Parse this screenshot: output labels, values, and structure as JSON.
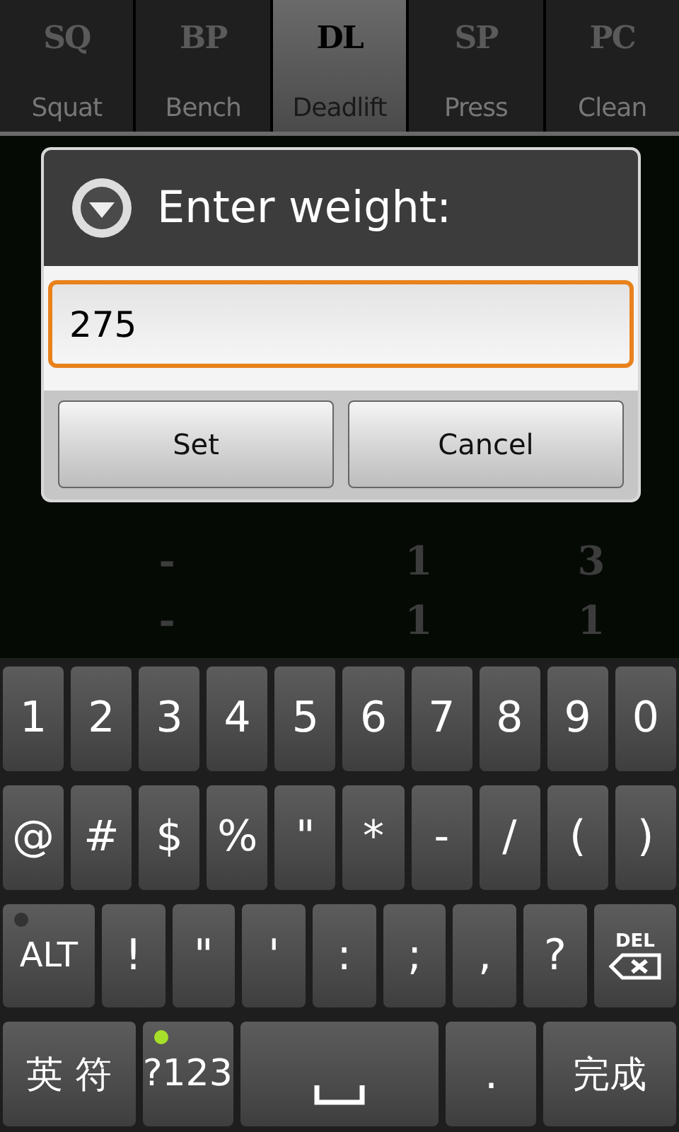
{
  "tabs": [
    {
      "abbr": "SQ",
      "label": "Squat",
      "selected": false
    },
    {
      "abbr": "BP",
      "label": "Bench",
      "selected": false
    },
    {
      "abbr": "DL",
      "label": "Deadlift",
      "selected": true
    },
    {
      "abbr": "SP",
      "label": "Press",
      "selected": false
    },
    {
      "abbr": "PC",
      "label": "Clean",
      "selected": false
    }
  ],
  "rows": [
    [
      "-",
      "1",
      "3"
    ],
    [
      "-",
      "1",
      "1"
    ]
  ],
  "dialog": {
    "title": "Enter weight:",
    "value": "275",
    "buttons": [
      "Set",
      "Cancel"
    ]
  },
  "keyboard": [
    [
      {
        "kind": "char",
        "label": "1"
      },
      {
        "kind": "char",
        "label": "2"
      },
      {
        "kind": "char",
        "label": "3"
      },
      {
        "kind": "char",
        "label": "4"
      },
      {
        "kind": "char",
        "label": "5"
      },
      {
        "kind": "char",
        "label": "6"
      },
      {
        "kind": "char",
        "label": "7"
      },
      {
        "kind": "char",
        "label": "8"
      },
      {
        "kind": "char",
        "label": "9"
      },
      {
        "kind": "char",
        "label": "0"
      }
    ],
    [
      {
        "kind": "char",
        "label": "@"
      },
      {
        "kind": "char",
        "label": "#"
      },
      {
        "kind": "char",
        "label": "$"
      },
      {
        "kind": "char",
        "label": "%"
      },
      {
        "kind": "char",
        "label": "\""
      },
      {
        "kind": "char",
        "label": "*"
      },
      {
        "kind": "char",
        "label": "-"
      },
      {
        "kind": "char",
        "label": "/"
      },
      {
        "kind": "char",
        "label": "("
      },
      {
        "kind": "char",
        "label": ")"
      }
    ],
    [
      {
        "kind": "toggle",
        "label": "ALT",
        "on": false
      },
      {
        "kind": "char",
        "label": "!"
      },
      {
        "kind": "char",
        "label": "\""
      },
      {
        "kind": "char",
        "label": "'"
      },
      {
        "kind": "char",
        "label": ":"
      },
      {
        "kind": "char",
        "label": ";"
      },
      {
        "kind": "char",
        "label": ","
      },
      {
        "kind": "char",
        "label": "?"
      },
      {
        "kind": "delete",
        "label": "DEL"
      }
    ],
    [
      {
        "kind": "wide",
        "label": "英 符"
      },
      {
        "kind": "toggle",
        "label": "?123",
        "on": true
      },
      {
        "kind": "space"
      },
      {
        "kind": "char",
        "label": "."
      },
      {
        "kind": "wide",
        "label": "完成"
      }
    ]
  ]
}
